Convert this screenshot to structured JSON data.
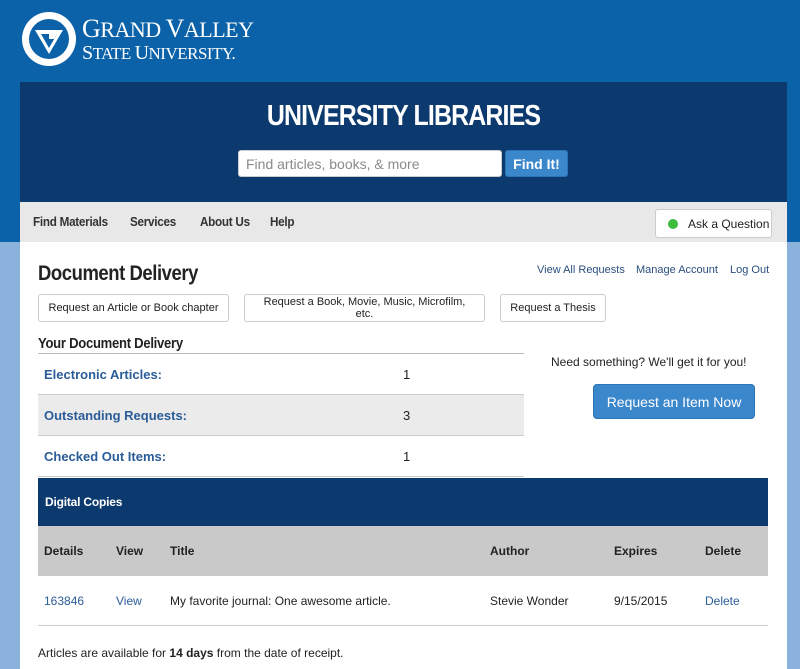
{
  "logo": {
    "line1_a": "G",
    "line1_b": "RAND ",
    "line1_c": "V",
    "line1_d": "ALLEY",
    "line2_a": "S",
    "line2_b": "TATE ",
    "line2_c": "U",
    "line2_d": "NIVERSITY",
    "line2_e": "."
  },
  "header": {
    "title": "UNIVERSITY LIBRARIES",
    "search_placeholder": "Find articles, books, & more",
    "search_button": "Find It!"
  },
  "nav": {
    "items": [
      "Find Materials",
      "Services",
      "About Us",
      "Help"
    ],
    "ask_label": "Ask a Question"
  },
  "page": {
    "title": "Document Delivery",
    "links": [
      "View All Requests",
      "Manage Account",
      "Log Out"
    ],
    "request_buttons": [
      "Request an Article or Book chapter",
      "Request a Book, Movie, Music, Microfilm, etc.",
      "Request a Thesis"
    ],
    "subtitle": "Your Document Delivery"
  },
  "summary": [
    {
      "label": "Electronic Articles:",
      "value": "1"
    },
    {
      "label": "Outstanding Requests:",
      "value": "3"
    },
    {
      "label": "Checked Out Items:",
      "value": "1"
    }
  ],
  "side": {
    "text": "Need something? We'll get it for you!",
    "button": "Request an Item Now"
  },
  "digital": {
    "heading": "Digital Copies",
    "columns": [
      "Details",
      "View",
      "Title",
      "Author",
      "Expires",
      "Delete"
    ],
    "rows": [
      {
        "details": "163846",
        "view": "View",
        "title": "My favorite journal: One awesome article.",
        "author": "Stevie Wonder",
        "expires": "9/15/2015",
        "delete": "Delete"
      }
    ]
  },
  "footnote": {
    "before": "Articles are available for ",
    "bold": "14 days",
    "after": " from the date of receipt."
  },
  "colors": {
    "top_blue": "#0b62a8",
    "navy": "#0d3a6e",
    "button_blue": "#3b87cc",
    "link": "#2a5c98",
    "page_bg": "#8ab2dc"
  }
}
